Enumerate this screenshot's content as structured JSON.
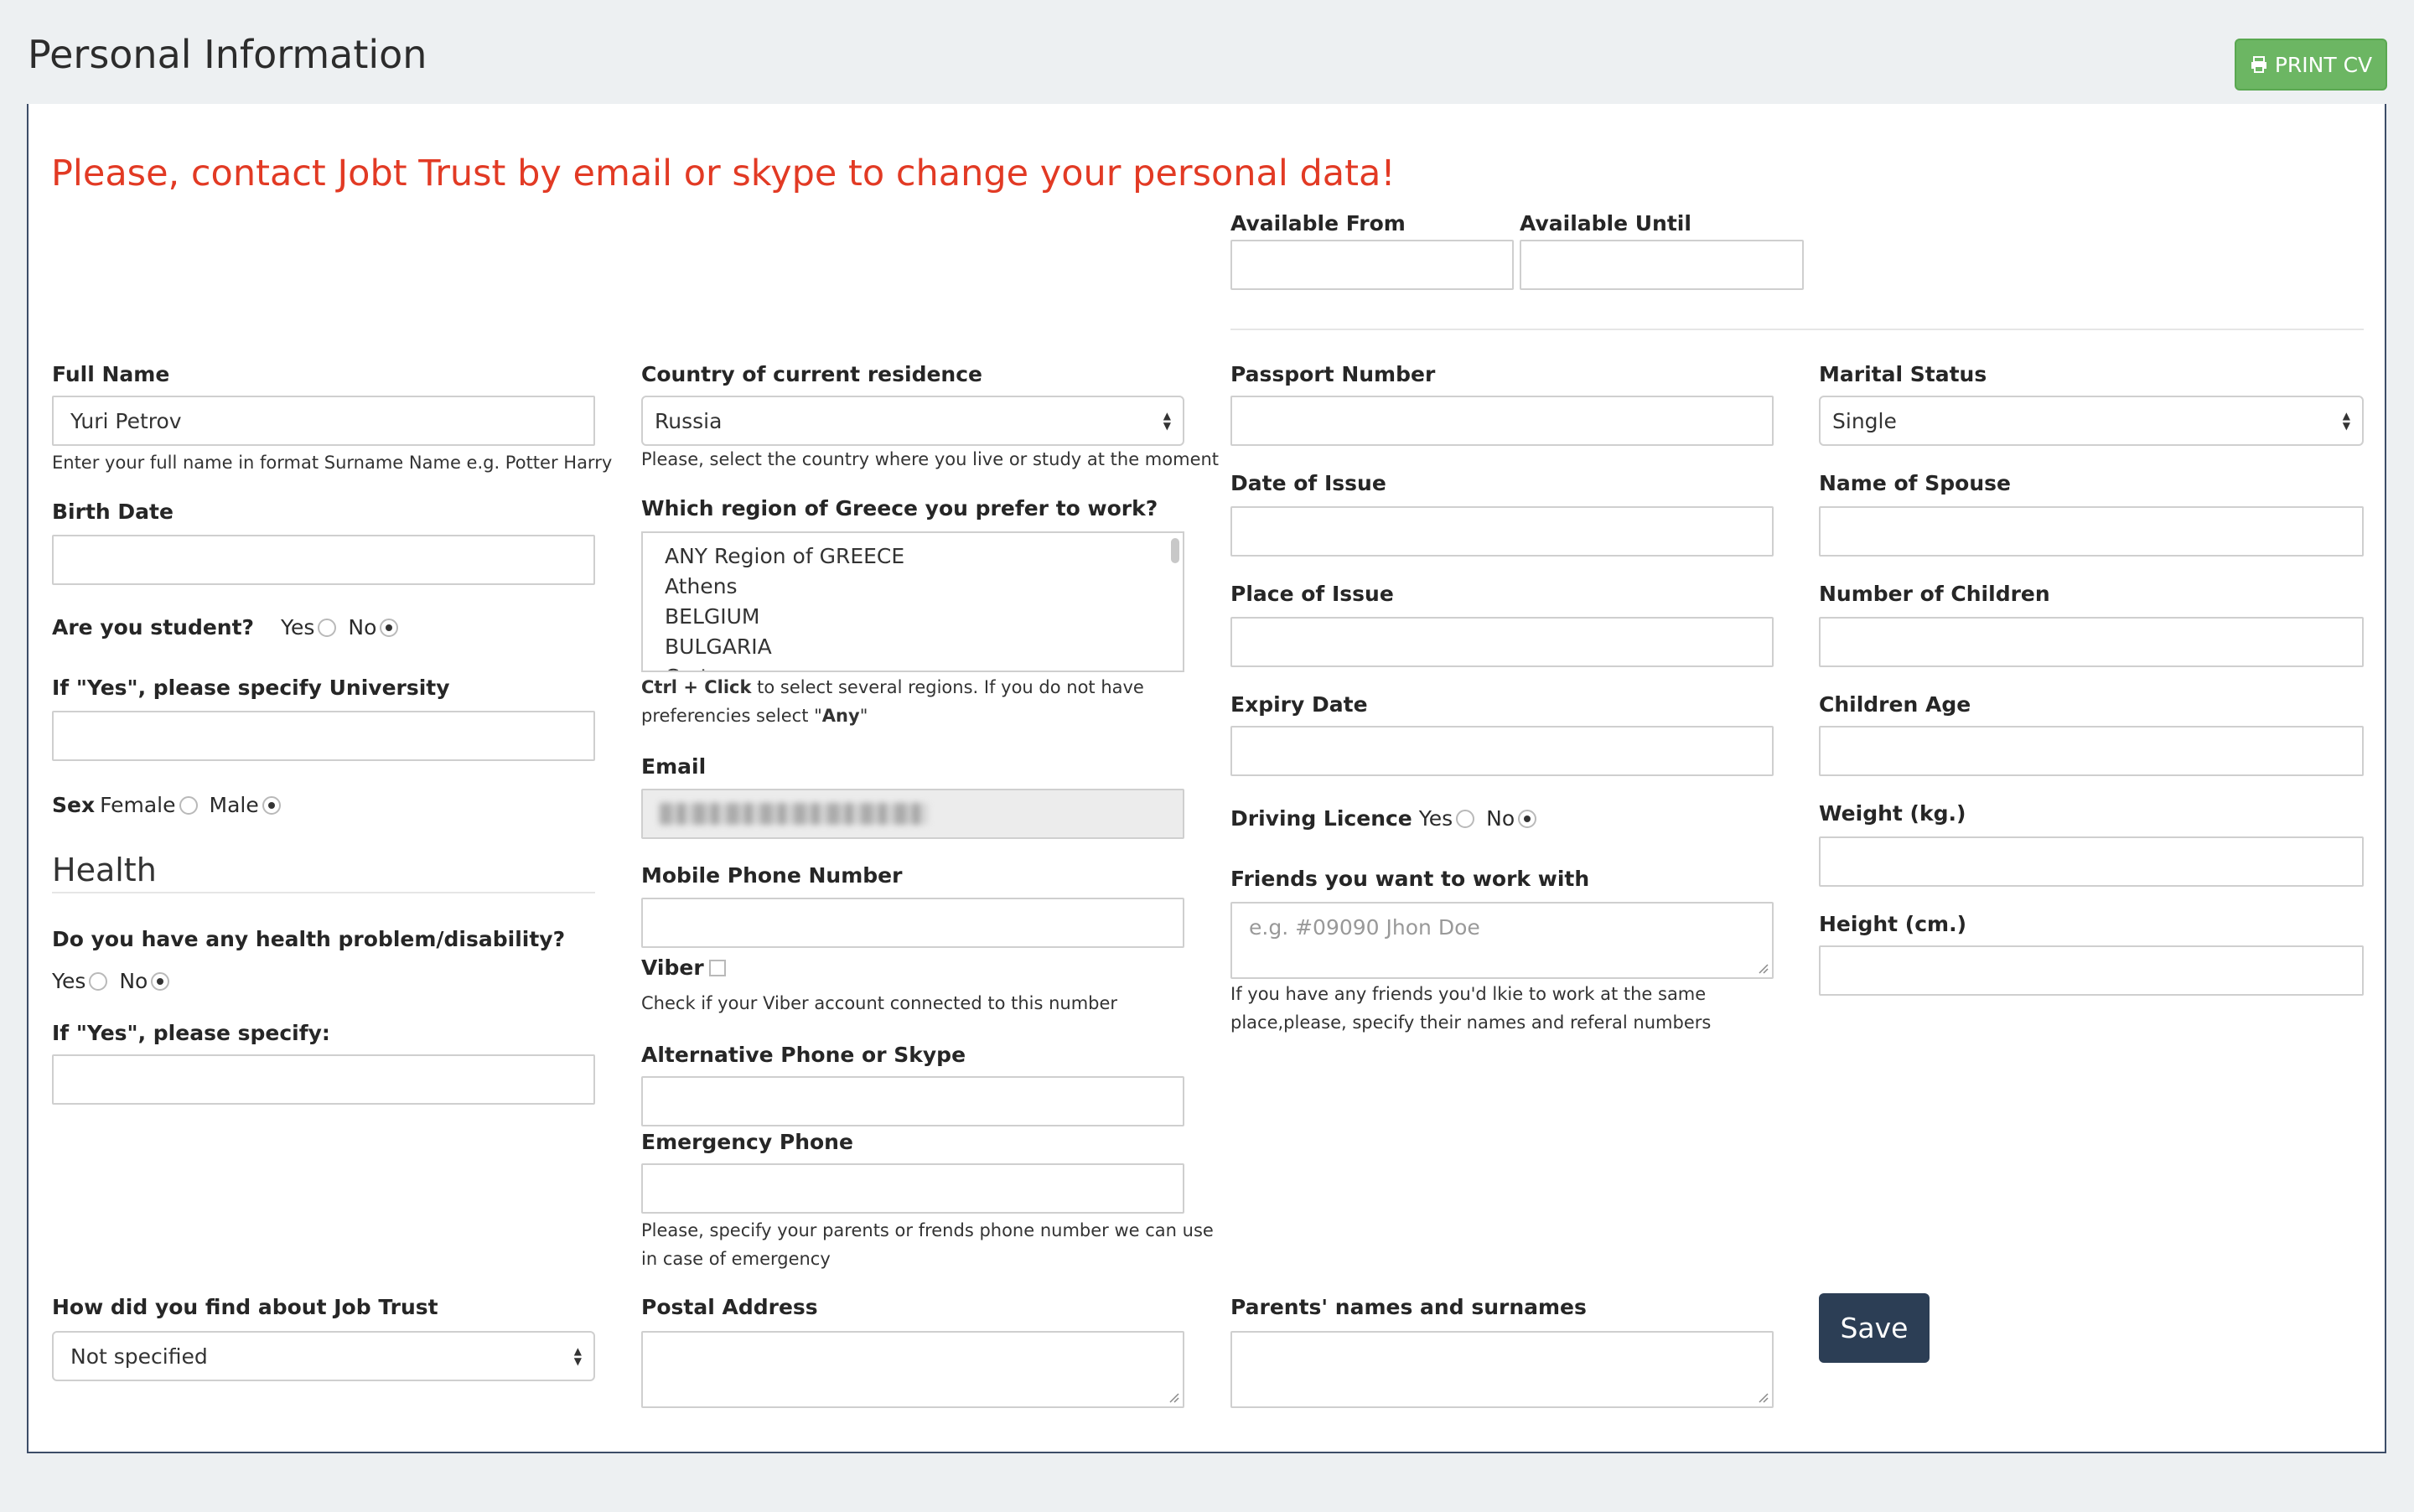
{
  "header": {
    "title": "Personal Information",
    "print_label": "PRINT CV",
    "print_icon": "printer-icon"
  },
  "notice": "Please, contact Jobt Trust by email or skype to change your personal data!",
  "availability": {
    "from_label": "Available From",
    "until_label": "Available Until",
    "from_value": "",
    "until_value": ""
  },
  "col1": {
    "full_name_label": "Full Name",
    "full_name_value": "Yuri Petrov",
    "full_name_help": "Enter your full name in format Surname Name e.g. Potter Harry",
    "birth_date_label": "Birth Date",
    "student_label": "Are you student?",
    "student_yes": "Yes",
    "student_no": "No",
    "student_selected": "No",
    "university_label": "If \"Yes\", please specify University",
    "sex_label": "Sex",
    "sex_female": "Female",
    "sex_male": "Male",
    "sex_selected": "Male",
    "health_title": "Health",
    "health_question": "Do you have any health problem/disability?",
    "health_yes": "Yes",
    "health_no": "No",
    "health_selected": "No",
    "health_specify_label": "If \"Yes\", please specify:",
    "find_label": "How did you find about Job Trust",
    "find_value": "Not specified"
  },
  "col2": {
    "country_label": "Country of current residence",
    "country_value": "Russia",
    "country_help": "Please, select the country where you live or study at the moment",
    "region_label": "Which region of Greece you prefer to work?",
    "region_options": [
      "ANY Region of GREECE",
      "Athens",
      "BELGIUM",
      "BULGARIA",
      "Crete"
    ],
    "region_help_bold1": "Ctrl + Click",
    "region_help_text1": " to select several regions. If you do not have",
    "region_help_text2": "preferencies select \"",
    "region_help_bold2": "Any",
    "region_help_text3": "\"",
    "email_label": "Email",
    "mobile_label": "Mobile Phone Number",
    "viber_label": "Viber",
    "viber_help": "Check if your Viber account connected to this number",
    "alt_phone_label": "Alternative Phone or Skype",
    "emergency_label": "Emergency Phone",
    "emergency_help_1": "Please, specify your parents or frends phone number we can use",
    "emergency_help_2": "in case of emergency",
    "postal_label": "Postal Address"
  },
  "col3": {
    "passport_label": "Passport Number",
    "issue_date_label": "Date of Issue",
    "issue_place_label": "Place of Issue",
    "expiry_label": "Expiry Date",
    "driving_label": "Driving Licence",
    "driving_yes": "Yes",
    "driving_no": "No",
    "driving_selected": "No",
    "friends_label": "Friends you want to work with",
    "friends_placeholder": "e.g. #09090 Jhon Doe",
    "friends_help_1": "If you have any friends you'd lkie to work at the same",
    "friends_help_2": "place,please, specify their names and referal numbers",
    "parents_label": "Parents' names and surnames"
  },
  "col4": {
    "marital_label": "Marital Status",
    "marital_value": "Single",
    "spouse_label": "Name of Spouse",
    "children_label": "Number of Children",
    "children_age_label": "Children Age",
    "weight_label": "Weight (kg.)",
    "height_label": "Height (cm.)",
    "save_label": "Save"
  },
  "colors": {
    "notice": "#e23a24",
    "print_button": "#6cb663",
    "save_button": "#2c3e55"
  }
}
